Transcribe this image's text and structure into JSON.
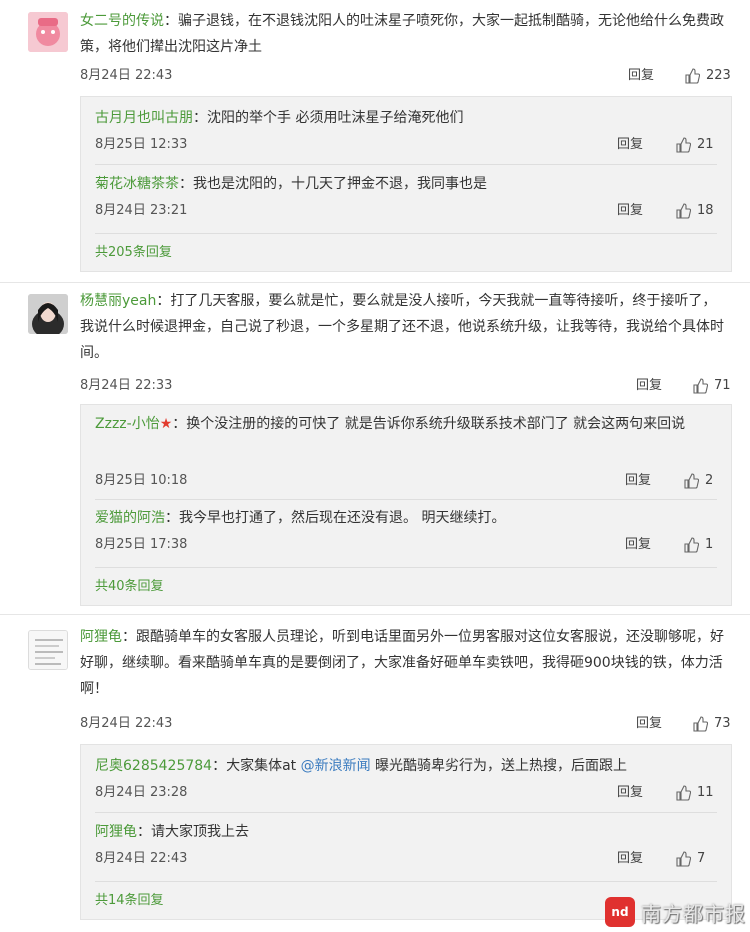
{
  "threads": [
    {
      "user": "女二号的传说",
      "text": "骗子退钱，在不退钱沈阳人的吐沫星子喷死你，大家一起抵制酷骑，无论他给什么免费政策，将他们撵出沈阳这片净土",
      "time": "8月24日 22:43",
      "reply": "回复",
      "likes": "223",
      "replies": [
        {
          "user": "古月月也叫古朋",
          "text": "沈阳的举个手 必须用吐沫星子给淹死他们",
          "time": "8月25日 12:33",
          "reply": "回复",
          "likes": "21"
        },
        {
          "user": "菊花冰糖茶茶",
          "text": "我也是沈阳的，十几天了押金不退，我同事也是",
          "time": "8月24日 23:21",
          "reply": "回复",
          "likes": "18"
        }
      ],
      "more": "共205条回复"
    },
    {
      "user": "杨慧丽yeah",
      "text": "打了几天客服，要么就是忙，要么就是没人接听，今天我就一直等待接听，终于接听了，我说什么时候退押金，自己说了秒退，一个多星期了还不退，他说系统升级，让我等待，我说给个具体时间。",
      "time": "8月24日 22:33",
      "reply": "回复",
      "likes": "71",
      "replies": [
        {
          "user": "Zzzz-小怡",
          "text": "换个没注册的接的可快了 就是告诉你系统升级联系技术部门了 就会这两句来回说",
          "time": "8月25日 10:18",
          "reply": "回复",
          "likes": "2"
        },
        {
          "user": "爱猫的阿浩",
          "text": "我今早也打通了，然后现在还没有退。 明天继续打。",
          "time": "8月25日 17:38",
          "reply": "回复",
          "likes": "1"
        }
      ],
      "more": "共40条回复"
    },
    {
      "user": "阿狸龟",
      "text": "跟酷骑单车的女客服人员理论，听到电话里面另外一位男客服对这位女客服说，还没聊够呢，好好聊，继续聊。看来酷骑单车真的是要倒闭了，大家准备好砸单车卖铁吧，我得砸900块钱的铁，体力活啊！",
      "time": "8月24日 22:43",
      "reply": "回复",
      "likes": "73",
      "replies": [
        {
          "user": "尼奥6285425784",
          "text_pre": "大家集体at ",
          "mention": "@新浪新闻",
          "text_post": " 曝光酷骑卑劣行为，送上热搜，后面跟上",
          "time": "8月24日 23:28",
          "reply": "回复",
          "likes": "11"
        },
        {
          "user": "阿狸龟",
          "text": "请大家顶我上去",
          "time": "8月24日 22:43",
          "reply": "回复",
          "likes": "7"
        }
      ],
      "more": "共14条回复"
    }
  ],
  "colon": "：",
  "watermark": {
    "logo": "nd",
    "text": "南方都市报"
  },
  "colors": {
    "username_blue": "#3a7bbf",
    "username_green": "#4c9a3a",
    "brand_red": "#e0312f"
  }
}
